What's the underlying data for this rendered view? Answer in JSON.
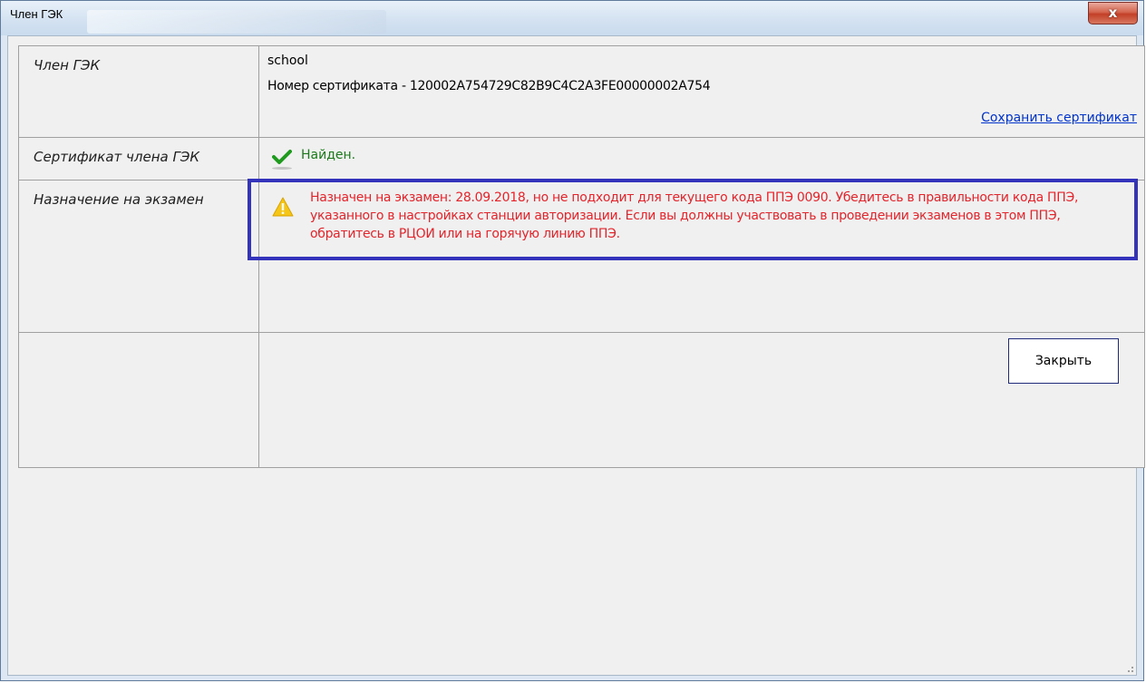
{
  "window": {
    "title": "Член ГЭК",
    "close_glyph": "x"
  },
  "rows": {
    "member": {
      "label": "Член ГЭК",
      "name": "school",
      "cert_number": "Номер сертификата - 120002A754729C82B9C4C2A3FE00000002A754",
      "save_link": "Сохранить сертификат"
    },
    "certificate": {
      "label": "Сертификат члена ГЭК",
      "status": "Найден.",
      "status_icon": "checkmark-icon",
      "status_color": "#1a7a1a"
    },
    "assignment": {
      "label": "Назначение на экзамен",
      "warning_icon": "warning-icon",
      "message": "Назначен на экзамен: 28.09.2018, но не подходит для текущего кода ППЭ 0090. Убедитесь в правильности кода ППЭ, указанного в настройках станции авторизации. Если вы должны участвовать в проведении экзаменов в этом ППЭ, обратитесь в РЦОИ или на горячую линию ППЭ.",
      "message_color": "#e3242b",
      "highlight_color": "#3333bb"
    },
    "actions": {
      "close_label": "Закрыть"
    }
  }
}
